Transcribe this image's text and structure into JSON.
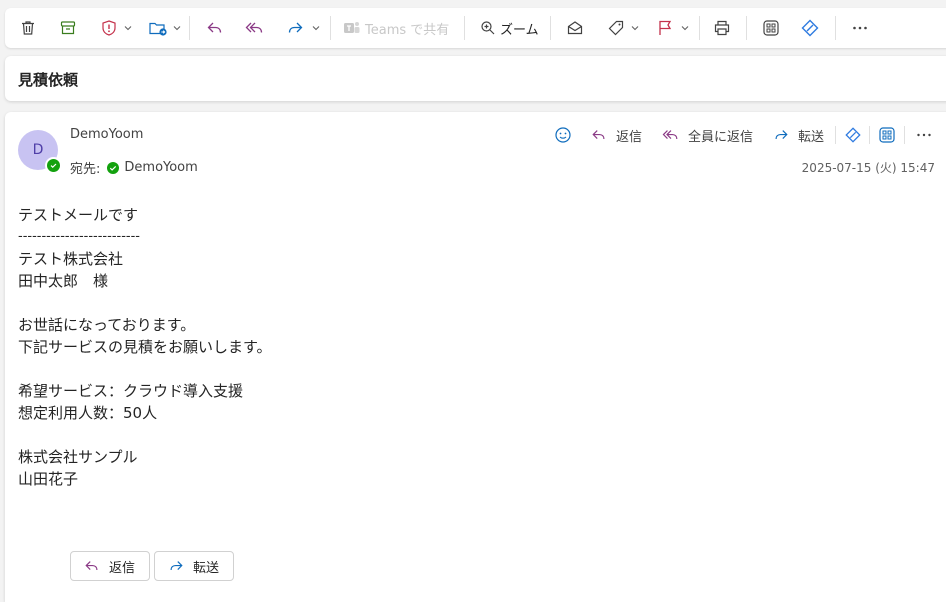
{
  "toolbar": {
    "teams_label": "Teams で共有",
    "zoom_label": "ズーム"
  },
  "subject": "見積依頼",
  "message": {
    "avatar_initial": "D",
    "sender": "DemoYoom",
    "to_prefix": "宛先:",
    "to_name": "DemoYoom",
    "date": "2025-07-15 (火) 15:47",
    "actions": {
      "reply": "返信",
      "reply_all": "全員に返信",
      "forward": "転送"
    },
    "body": {
      "line1": "テストメールです",
      "line2": "--------------------------",
      "line3": "テスト株式会社",
      "line4": "田中太郎　様",
      "line5": "お世話になっております。",
      "line6": "下記サービスの見積をお願いします。",
      "line7": "希望サービス：クラウド導入支援",
      "line8": "想定利用人数：50人",
      "line9": "株式会社サンプル",
      "line10": "山田花子"
    },
    "bottom_buttons": {
      "reply": "返信",
      "forward": "転送"
    }
  },
  "colors": {
    "accent_blue": "#0f6cbd",
    "reply_purple": "#8b3a86",
    "delete_red": "#c4314b",
    "presence_green": "#13a10e"
  }
}
